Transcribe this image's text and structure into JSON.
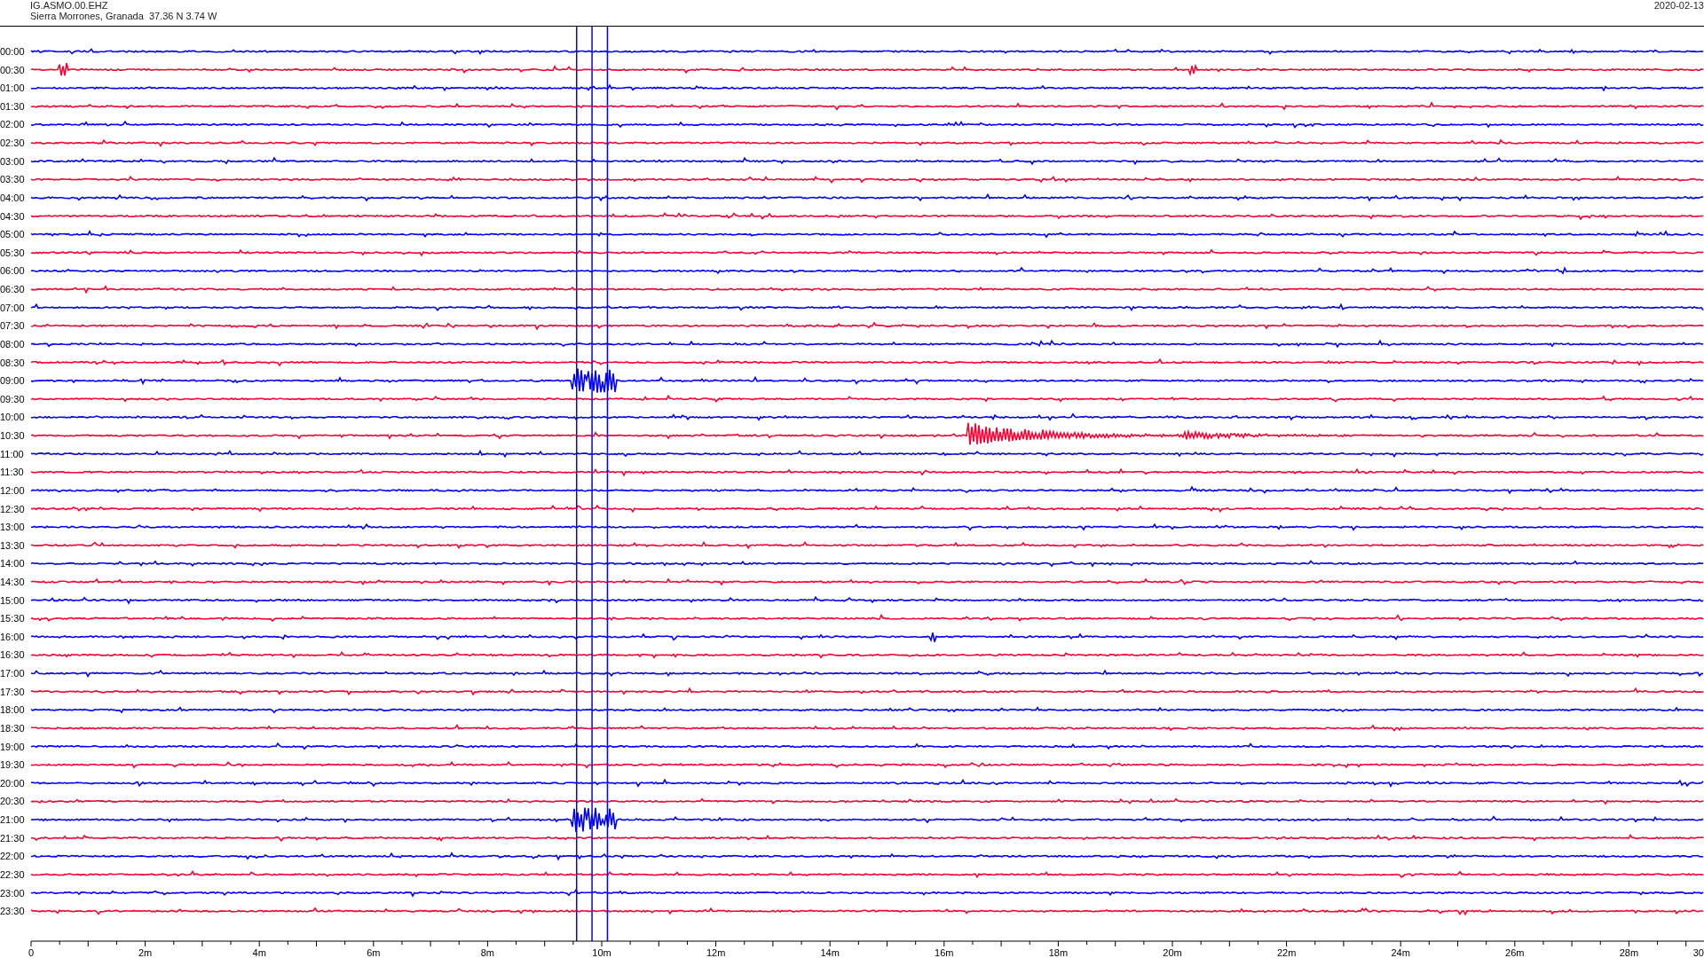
{
  "header": {
    "station": "IG.ASMO.00.EHZ",
    "location": "Sierra Morrones, Granada  37.36 N 3.74 W",
    "date": "2020-02-13"
  },
  "rows": [
    {
      "label": "00:00",
      "color": "#0000ff"
    },
    {
      "label": "00:30",
      "color": "#ff0033"
    },
    {
      "label": "01:00",
      "color": "#0000ff"
    },
    {
      "label": "01:30",
      "color": "#ff0033"
    },
    {
      "label": "02:00",
      "color": "#0000ff"
    },
    {
      "label": "02:30",
      "color": "#ff0033"
    },
    {
      "label": "03:00",
      "color": "#0000ff"
    },
    {
      "label": "03:30",
      "color": "#ff0033"
    },
    {
      "label": "04:00",
      "color": "#0000ff"
    },
    {
      "label": "04:30",
      "color": "#ff0033"
    },
    {
      "label": "05:00",
      "color": "#0000ff"
    },
    {
      "label": "05:30",
      "color": "#ff0033"
    },
    {
      "label": "06:00",
      "color": "#0000ff"
    },
    {
      "label": "06:30",
      "color": "#ff0033"
    },
    {
      "label": "07:00",
      "color": "#0000ff"
    },
    {
      "label": "07:30",
      "color": "#ff0033"
    },
    {
      "label": "08:00",
      "color": "#0000ff"
    },
    {
      "label": "08:30",
      "color": "#ff0033"
    },
    {
      "label": "09:00",
      "color": "#0000ff"
    },
    {
      "label": "09:30",
      "color": "#ff0033"
    },
    {
      "label": "10:00",
      "color": "#0000ff"
    },
    {
      "label": "10:30",
      "color": "#ff0033"
    },
    {
      "label": "11:00",
      "color": "#0000ff"
    },
    {
      "label": "11:30",
      "color": "#ff0033"
    },
    {
      "label": "12:00",
      "color": "#0000ff"
    },
    {
      "label": "12:30",
      "color": "#ff0033"
    },
    {
      "label": "13:00",
      "color": "#0000ff"
    },
    {
      "label": "13:30",
      "color": "#ff0033"
    },
    {
      "label": "14:00",
      "color": "#0000ff"
    },
    {
      "label": "14:30",
      "color": "#ff0033"
    },
    {
      "label": "15:00",
      "color": "#0000ff"
    },
    {
      "label": "15:30",
      "color": "#ff0033"
    },
    {
      "label": "16:00",
      "color": "#0000ff"
    },
    {
      "label": "16:30",
      "color": "#ff0033"
    },
    {
      "label": "17:00",
      "color": "#0000ff"
    },
    {
      "label": "17:30",
      "color": "#ff0033"
    },
    {
      "label": "18:00",
      "color": "#0000ff"
    },
    {
      "label": "18:30",
      "color": "#ff0033"
    },
    {
      "label": "19:00",
      "color": "#0000ff"
    },
    {
      "label": "19:30",
      "color": "#ff0033"
    },
    {
      "label": "20:00",
      "color": "#0000ff"
    },
    {
      "label": "20:30",
      "color": "#ff0033"
    },
    {
      "label": "21:00",
      "color": "#0000ff"
    },
    {
      "label": "21:30",
      "color": "#ff0033"
    },
    {
      "label": "22:00",
      "color": "#0000ff"
    },
    {
      "label": "22:30",
      "color": "#ff0033"
    },
    {
      "label": "23:00",
      "color": "#0000ff"
    },
    {
      "label": "23:30",
      "color": "#ff0033"
    }
  ],
  "axis_labels": [
    "0",
    "2m",
    "4m",
    "6m",
    "8m",
    "10m",
    "12m",
    "14m",
    "16m",
    "18m",
    "20m",
    "22m",
    "24m",
    "26m",
    "28m",
    "30"
  ]
}
